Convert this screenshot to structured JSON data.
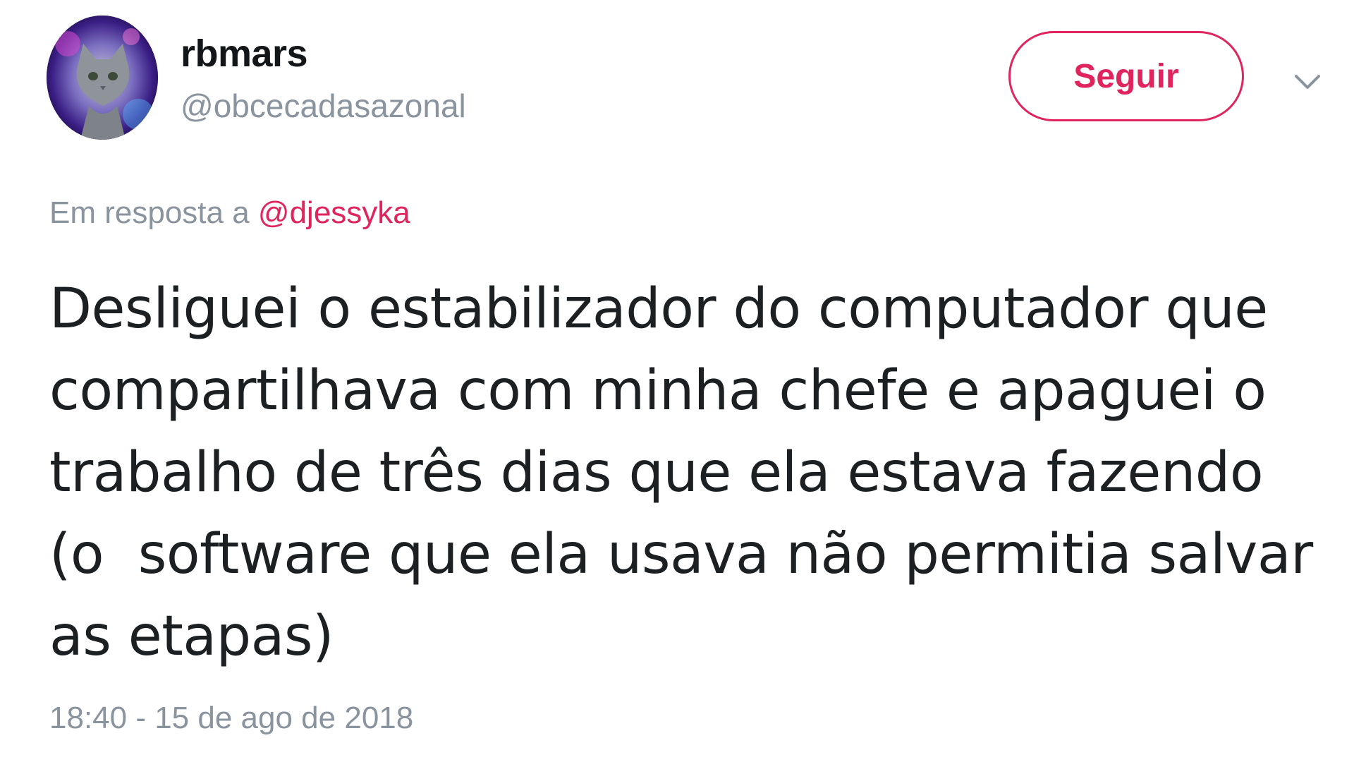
{
  "user": {
    "name": "rbmars",
    "handle": "@obcecadasazonal",
    "avatar_icon": "cat-galaxy-avatar"
  },
  "actions": {
    "follow_label": "Seguir",
    "more_icon": "chevron-down-icon"
  },
  "reply": {
    "prefix": "Em resposta a",
    "to_handle": "@djessyka"
  },
  "tweet": {
    "lines": [
      "Desliguei o estabilizador do computador que",
      "compartilhava com minha chefe e apaguei o",
      "trabalho de três dias que ela estava fazendo",
      "(o  software que ela usava não permitia salvar",
      "as etapas)"
    ],
    "timestamp": "18:40 - 15 de ago de 2018"
  },
  "colors": {
    "accent": "#e0245e",
    "muted": "#8a949e",
    "text": "#1c2022"
  }
}
